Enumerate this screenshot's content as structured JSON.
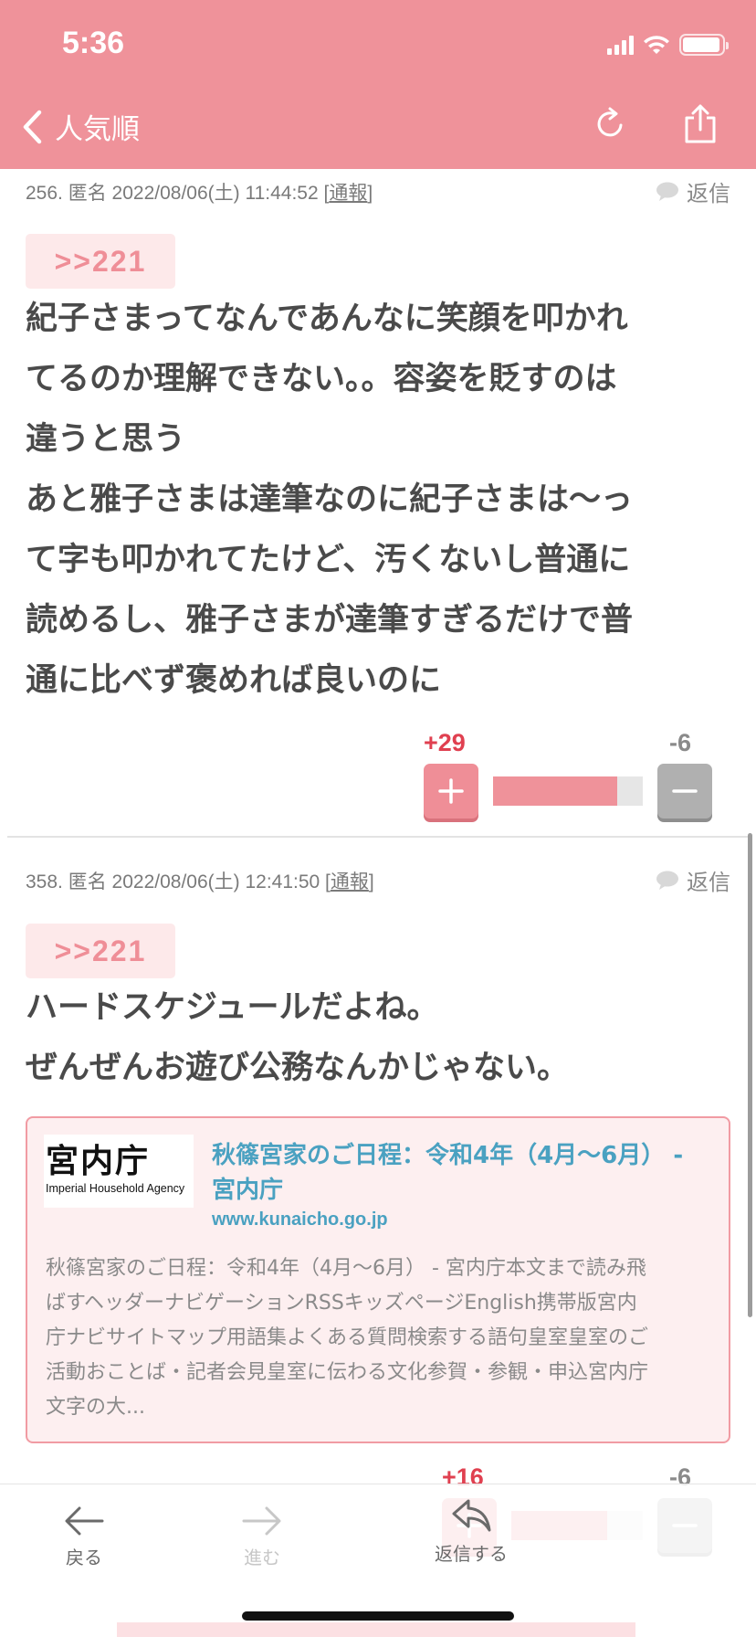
{
  "status_bar": {
    "time": "5:36"
  },
  "nav": {
    "back_title": "人気順",
    "icons": [
      "back-chevron-icon",
      "refresh-icon",
      "share-icon"
    ]
  },
  "posts": [
    {
      "meta_prefix": "256. 匿名 2022/08/06(土) 11:44:52 [",
      "report": "通報",
      "meta_suffix": "]",
      "reply_label": "返信",
      "anchor": ">>221",
      "body_lines": [
        "紀子さまってなんであんなに笑顔を叩かれ",
        "てるのか理解できない。。容姿を貶すのは",
        "違うと思う",
        "あと雅子さまは達筆なのに紀子さまは〜っ",
        "て字も叩かれてたけど、汚くないし普通に",
        "読めるし、雅子さまが達筆すぎるだけで普",
        "通に比べず褒めれば良いのに"
      ],
      "plus_count": "+29",
      "minus_count": "-6",
      "plus_ratio": 0.83
    },
    {
      "meta_prefix": "358. 匿名 2022/08/06(土) 12:41:50 [",
      "report": "通報",
      "meta_suffix": "]",
      "reply_label": "返信",
      "anchor": ">>221",
      "body_lines": [
        "ハードスケジュールだよね。",
        "ぜんぜんお遊び公務なんかじゃない。"
      ],
      "link_card": {
        "logo_text": "宮内庁",
        "logo_subtext": "Imperial Household Agency",
        "title": "秋篠宮家のご日程：令和4年（4月～6月） - 宮内庁",
        "domain": "www.kunaicho.go.jp",
        "description_lines": [
          "秋篠宮家のご日程：令和4年（4月～6月） - 宮内庁本文まで読み飛",
          "ばすヘッダーナビゲーションRSSキッズページEnglish携帯版宮内",
          "庁ナビサイトマップ用語集よくある質問検索する語句皇室皇室のご",
          "活動おことば・記者会見皇室に伝わる文化参賀・参観・申込宮内庁",
          "文字の大..."
        ]
      },
      "plus_count": "+16",
      "minus_count": "-6",
      "plus_ratio": 0.73
    }
  ],
  "toolbar": {
    "back_label": "戻る",
    "forward_label": "進む",
    "reply_label": "返信する"
  },
  "colors": {
    "accent": "#ef929a",
    "link": "#4aa1c1",
    "plus": "#e04050"
  }
}
